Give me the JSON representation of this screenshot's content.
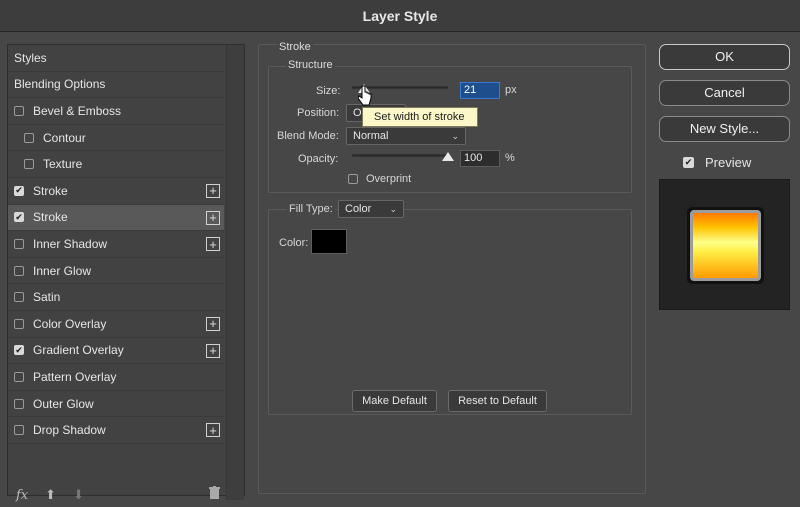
{
  "window": {
    "title": "Layer Style"
  },
  "styles_list": {
    "items": [
      {
        "label": "Styles",
        "type": "header",
        "checked": false,
        "has_plus": false
      },
      {
        "label": "Blending Options",
        "type": "header",
        "checked": false,
        "has_plus": false
      },
      {
        "label": "Bevel & Emboss",
        "type": "item",
        "checked": false,
        "has_plus": false
      },
      {
        "label": "Contour",
        "type": "sub",
        "checked": false,
        "has_plus": false
      },
      {
        "label": "Texture",
        "type": "sub",
        "checked": false,
        "has_plus": false
      },
      {
        "label": "Stroke",
        "type": "item",
        "checked": true,
        "has_plus": true
      },
      {
        "label": "Stroke",
        "type": "item",
        "checked": true,
        "has_plus": true,
        "selected": true
      },
      {
        "label": "Inner Shadow",
        "type": "item",
        "checked": false,
        "has_plus": true
      },
      {
        "label": "Inner Glow",
        "type": "item",
        "checked": false,
        "has_plus": false
      },
      {
        "label": "Satin",
        "type": "item",
        "checked": false,
        "has_plus": false
      },
      {
        "label": "Color Overlay",
        "type": "item",
        "checked": false,
        "has_plus": true
      },
      {
        "label": "Gradient Overlay",
        "type": "item",
        "checked": true,
        "has_plus": true
      },
      {
        "label": "Pattern Overlay",
        "type": "item",
        "checked": false,
        "has_plus": false
      },
      {
        "label": "Outer Glow",
        "type": "item",
        "checked": false,
        "has_plus": false
      },
      {
        "label": "Drop Shadow",
        "type": "item",
        "checked": false,
        "has_plus": true
      }
    ],
    "bottom": {
      "fx": "fx",
      "up": "⬆",
      "down": "⬇",
      "trash": "🗑"
    }
  },
  "stroke": {
    "group_title": "Stroke",
    "structure_title": "Structure",
    "size_label": "Size:",
    "size_value": "21",
    "size_unit": "px",
    "position_label": "Position:",
    "position_value": "O",
    "blend_mode_label": "Blend Mode:",
    "blend_mode_value": "Normal",
    "opacity_label": "Opacity:",
    "opacity_value": "100",
    "opacity_unit": "%",
    "overprint_label": "Overprint",
    "tooltip": "Set width of stroke",
    "fill_type_label": "Fill Type:",
    "fill_type_value": "Color",
    "color_label": "Color:",
    "color_value": "#000000"
  },
  "buttons": {
    "make_default": "Make Default",
    "reset_default": "Reset to Default",
    "ok": "OK",
    "cancel": "Cancel",
    "new_style": "New Style...",
    "preview": "Preview"
  },
  "colors": {
    "panel": "#474747",
    "gradient_top": "#ff6a00",
    "gradient_mid": "#ffff66",
    "gradient_bottom": "#ff8c00"
  }
}
